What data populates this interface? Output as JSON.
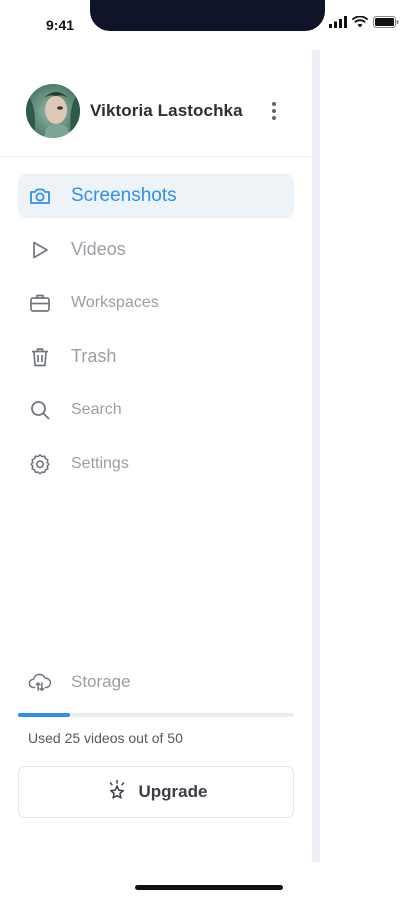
{
  "status": {
    "time": "9:41"
  },
  "profile": {
    "name": "Viktoria Lastochka"
  },
  "nav": {
    "items": [
      {
        "label": "Screenshots",
        "icon": "camera-icon",
        "active": true
      },
      {
        "label": "Videos",
        "icon": "play-icon",
        "active": false
      },
      {
        "label": "Workspaces",
        "icon": "briefcase-icon",
        "active": false
      },
      {
        "label": "Trash",
        "icon": "trash-icon",
        "active": false
      },
      {
        "label": "Search",
        "icon": "search-icon",
        "active": false
      },
      {
        "label": "Settings",
        "icon": "gear-icon",
        "active": false
      }
    ]
  },
  "storage": {
    "label": "Storage",
    "icon": "cloud-upload-icon",
    "usage_text": "Used 25 videos out of 50",
    "used": 25,
    "total": 50
  },
  "upgrade": {
    "label": "Upgrade",
    "icon": "sparkle-star-icon"
  },
  "colors": {
    "accent": "#2e8ff0",
    "muted_text": "#9a9ea5",
    "active_bg": "#eef3f8"
  }
}
